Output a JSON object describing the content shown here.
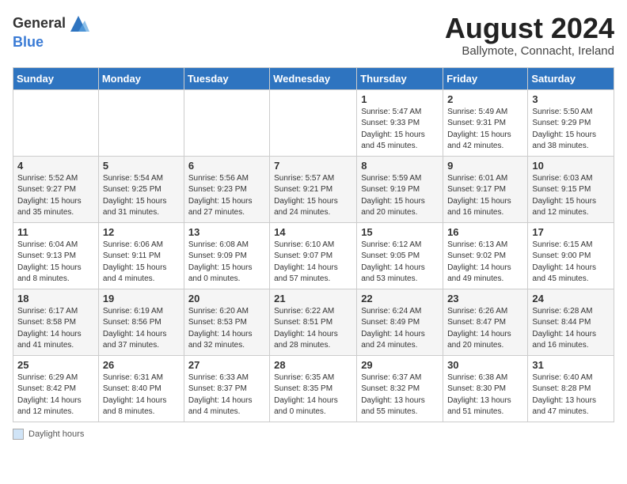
{
  "header": {
    "logo_general": "General",
    "logo_blue": "Blue",
    "title": "August 2024",
    "subtitle": "Ballymote, Connacht, Ireland"
  },
  "days_of_week": [
    "Sunday",
    "Monday",
    "Tuesday",
    "Wednesday",
    "Thursday",
    "Friday",
    "Saturday"
  ],
  "footer": {
    "label": "Daylight hours"
  },
  "weeks": [
    [
      {
        "day": "",
        "info": ""
      },
      {
        "day": "",
        "info": ""
      },
      {
        "day": "",
        "info": ""
      },
      {
        "day": "",
        "info": ""
      },
      {
        "day": "1",
        "info": "Sunrise: 5:47 AM\nSunset: 9:33 PM\nDaylight: 15 hours\nand 45 minutes."
      },
      {
        "day": "2",
        "info": "Sunrise: 5:49 AM\nSunset: 9:31 PM\nDaylight: 15 hours\nand 42 minutes."
      },
      {
        "day": "3",
        "info": "Sunrise: 5:50 AM\nSunset: 9:29 PM\nDaylight: 15 hours\nand 38 minutes."
      }
    ],
    [
      {
        "day": "4",
        "info": "Sunrise: 5:52 AM\nSunset: 9:27 PM\nDaylight: 15 hours\nand 35 minutes."
      },
      {
        "day": "5",
        "info": "Sunrise: 5:54 AM\nSunset: 9:25 PM\nDaylight: 15 hours\nand 31 minutes."
      },
      {
        "day": "6",
        "info": "Sunrise: 5:56 AM\nSunset: 9:23 PM\nDaylight: 15 hours\nand 27 minutes."
      },
      {
        "day": "7",
        "info": "Sunrise: 5:57 AM\nSunset: 9:21 PM\nDaylight: 15 hours\nand 24 minutes."
      },
      {
        "day": "8",
        "info": "Sunrise: 5:59 AM\nSunset: 9:19 PM\nDaylight: 15 hours\nand 20 minutes."
      },
      {
        "day": "9",
        "info": "Sunrise: 6:01 AM\nSunset: 9:17 PM\nDaylight: 15 hours\nand 16 minutes."
      },
      {
        "day": "10",
        "info": "Sunrise: 6:03 AM\nSunset: 9:15 PM\nDaylight: 15 hours\nand 12 minutes."
      }
    ],
    [
      {
        "day": "11",
        "info": "Sunrise: 6:04 AM\nSunset: 9:13 PM\nDaylight: 15 hours\nand 8 minutes."
      },
      {
        "day": "12",
        "info": "Sunrise: 6:06 AM\nSunset: 9:11 PM\nDaylight: 15 hours\nand 4 minutes."
      },
      {
        "day": "13",
        "info": "Sunrise: 6:08 AM\nSunset: 9:09 PM\nDaylight: 15 hours\nand 0 minutes."
      },
      {
        "day": "14",
        "info": "Sunrise: 6:10 AM\nSunset: 9:07 PM\nDaylight: 14 hours\nand 57 minutes."
      },
      {
        "day": "15",
        "info": "Sunrise: 6:12 AM\nSunset: 9:05 PM\nDaylight: 14 hours\nand 53 minutes."
      },
      {
        "day": "16",
        "info": "Sunrise: 6:13 AM\nSunset: 9:02 PM\nDaylight: 14 hours\nand 49 minutes."
      },
      {
        "day": "17",
        "info": "Sunrise: 6:15 AM\nSunset: 9:00 PM\nDaylight: 14 hours\nand 45 minutes."
      }
    ],
    [
      {
        "day": "18",
        "info": "Sunrise: 6:17 AM\nSunset: 8:58 PM\nDaylight: 14 hours\nand 41 minutes."
      },
      {
        "day": "19",
        "info": "Sunrise: 6:19 AM\nSunset: 8:56 PM\nDaylight: 14 hours\nand 37 minutes."
      },
      {
        "day": "20",
        "info": "Sunrise: 6:20 AM\nSunset: 8:53 PM\nDaylight: 14 hours\nand 32 minutes."
      },
      {
        "day": "21",
        "info": "Sunrise: 6:22 AM\nSunset: 8:51 PM\nDaylight: 14 hours\nand 28 minutes."
      },
      {
        "day": "22",
        "info": "Sunrise: 6:24 AM\nSunset: 8:49 PM\nDaylight: 14 hours\nand 24 minutes."
      },
      {
        "day": "23",
        "info": "Sunrise: 6:26 AM\nSunset: 8:47 PM\nDaylight: 14 hours\nand 20 minutes."
      },
      {
        "day": "24",
        "info": "Sunrise: 6:28 AM\nSunset: 8:44 PM\nDaylight: 14 hours\nand 16 minutes."
      }
    ],
    [
      {
        "day": "25",
        "info": "Sunrise: 6:29 AM\nSunset: 8:42 PM\nDaylight: 14 hours\nand 12 minutes."
      },
      {
        "day": "26",
        "info": "Sunrise: 6:31 AM\nSunset: 8:40 PM\nDaylight: 14 hours\nand 8 minutes."
      },
      {
        "day": "27",
        "info": "Sunrise: 6:33 AM\nSunset: 8:37 PM\nDaylight: 14 hours\nand 4 minutes."
      },
      {
        "day": "28",
        "info": "Sunrise: 6:35 AM\nSunset: 8:35 PM\nDaylight: 14 hours\nand 0 minutes."
      },
      {
        "day": "29",
        "info": "Sunrise: 6:37 AM\nSunset: 8:32 PM\nDaylight: 13 hours\nand 55 minutes."
      },
      {
        "day": "30",
        "info": "Sunrise: 6:38 AM\nSunset: 8:30 PM\nDaylight: 13 hours\nand 51 minutes."
      },
      {
        "day": "31",
        "info": "Sunrise: 6:40 AM\nSunset: 8:28 PM\nDaylight: 13 hours\nand 47 minutes."
      }
    ]
  ]
}
